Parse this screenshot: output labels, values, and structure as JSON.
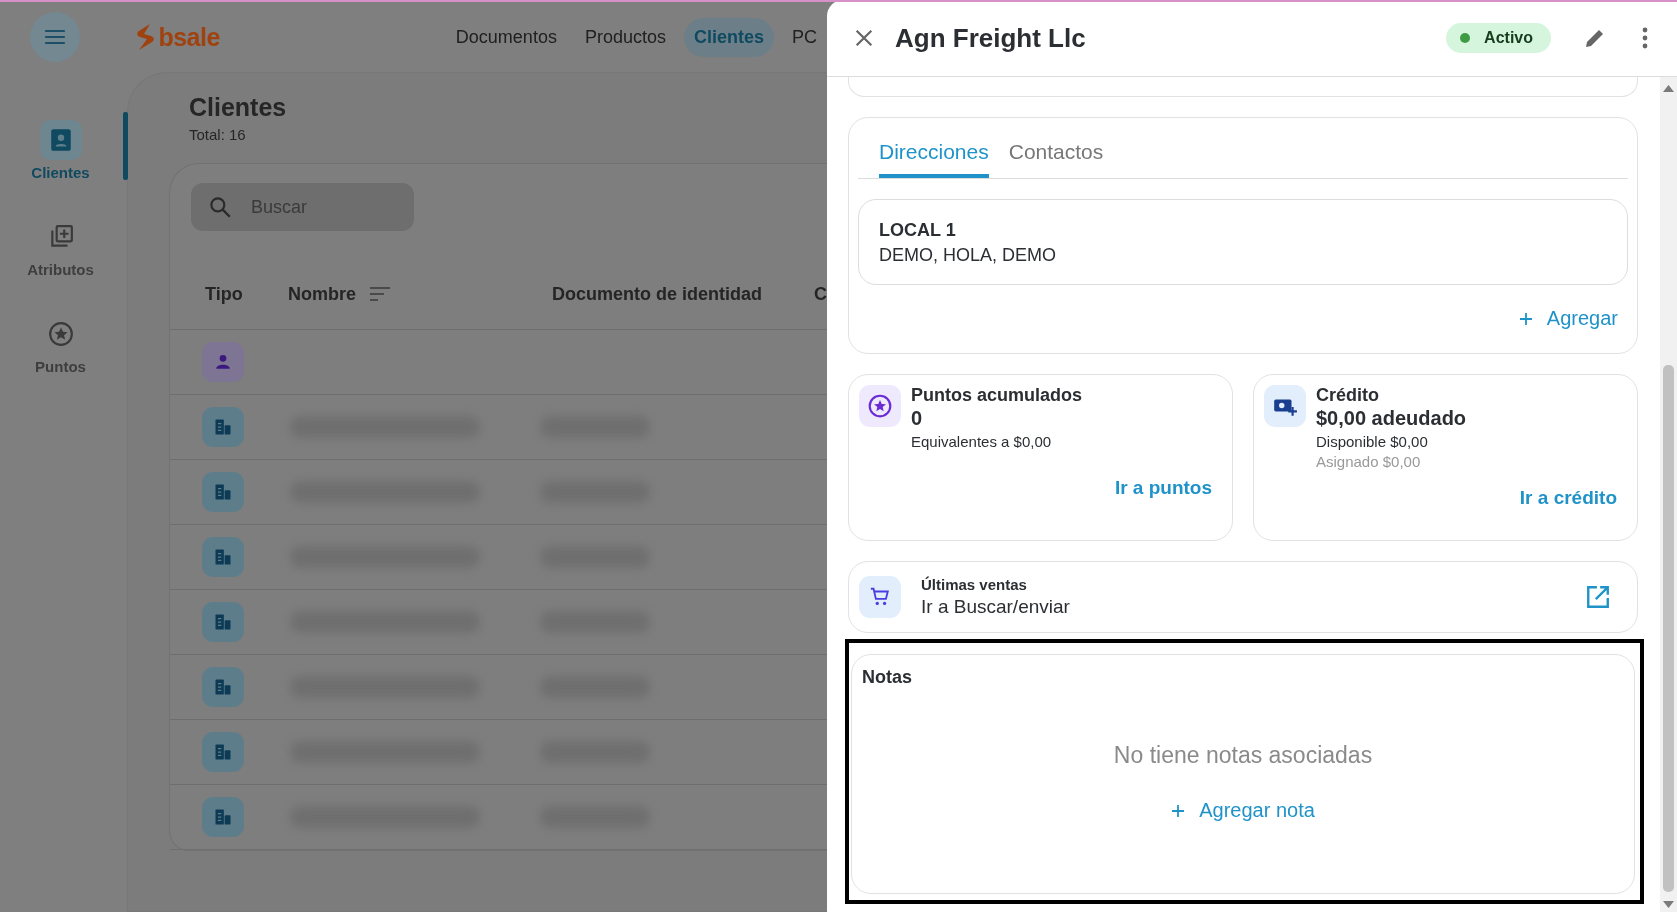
{
  "app": {
    "logo": "bsale",
    "nav": [
      {
        "label": "Documentos",
        "selected": false
      },
      {
        "label": "Productos",
        "selected": false
      },
      {
        "label": "Clientes",
        "selected": true
      },
      {
        "label": "PC",
        "selected": false
      }
    ]
  },
  "sidebar": {
    "items": [
      {
        "label": "Clientes",
        "kind": "clients",
        "selected": true
      },
      {
        "label": "Atributos",
        "kind": "attributes",
        "selected": false
      },
      {
        "label": "Puntos",
        "kind": "points",
        "selected": false
      }
    ]
  },
  "page": {
    "title": "Clientes",
    "total": "Total: 16",
    "search": {
      "placeholder": "Buscar"
    },
    "table": {
      "columns": [
        "Tipo",
        "Nombre",
        "Documento de identidad",
        "C"
      ],
      "rows": [
        {
          "kind": "person",
          "blurred": false
        },
        {
          "kind": "company",
          "blurred": true
        },
        {
          "kind": "company",
          "blurred": true
        },
        {
          "kind": "company",
          "blurred": true
        },
        {
          "kind": "company",
          "blurred": true
        },
        {
          "kind": "company",
          "blurred": true
        },
        {
          "kind": "company",
          "blurred": true
        },
        {
          "kind": "company",
          "blurred": true
        }
      ]
    }
  },
  "drawer": {
    "title": "Agn Freight Llc",
    "status": "Activo",
    "tabs": [
      {
        "label": "Direcciones",
        "selected": true
      },
      {
        "label": "Contactos",
        "selected": false
      }
    ],
    "addresses": [
      {
        "name": "LOCAL 1",
        "detail": "DEMO, HOLA, DEMO"
      }
    ],
    "add_label": "Agregar",
    "points": {
      "title": "Puntos acumulados",
      "value": "0",
      "note": "Equivalentes a $0,00",
      "link": "Ir a puntos"
    },
    "credit": {
      "title": "Crédito",
      "value": "$0,00 adeudado",
      "lines": [
        {
          "text": "Disponible $0,00",
          "muted": false
        },
        {
          "text": "Asignado $0,00",
          "muted": true
        }
      ],
      "link": "Ir a crédito"
    },
    "sales": {
      "title": "Últimas ventas",
      "subtitle": "Ir a Buscar/enviar"
    },
    "notes": {
      "title": "Notas",
      "empty": "No tiene notas asociadas",
      "add": "Agregar nota",
      "highlighted": true
    }
  }
}
